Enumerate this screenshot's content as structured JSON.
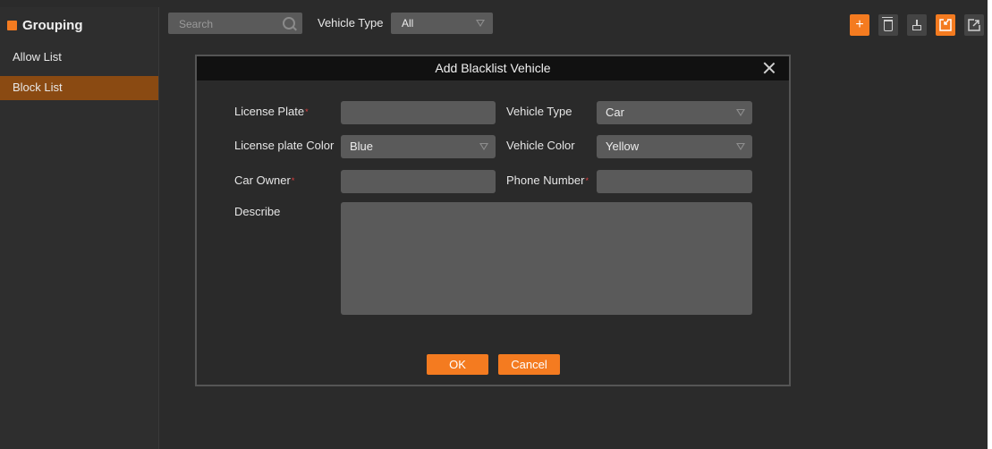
{
  "sidebar": {
    "title": "Grouping",
    "items": [
      {
        "label": "Allow List"
      },
      {
        "label": "Block List"
      }
    ]
  },
  "topbar": {
    "search_placeholder": "Search",
    "vehicle_type_label": "Vehicle Type",
    "vehicle_type_value": "All"
  },
  "toolbar": {
    "add_symbol": "+",
    "icons": [
      "add-icon",
      "trash-icon",
      "clean-icon",
      "import-icon",
      "export-icon"
    ]
  },
  "dialog": {
    "title": "Add Blacklist Vehicle",
    "fields": {
      "license_plate": {
        "label": "License Plate",
        "required": "*",
        "value": ""
      },
      "vehicle_type": {
        "label": "Vehicle Type",
        "value": "Car"
      },
      "plate_color": {
        "label": "License plate Color",
        "value": "Blue"
      },
      "vehicle_color": {
        "label": "Vehicle Color",
        "value": "Yellow"
      },
      "car_owner": {
        "label": "Car Owner",
        "required": "*",
        "value": ""
      },
      "phone_number": {
        "label": "Phone Number",
        "required": "*",
        "value": ""
      },
      "describe": {
        "label": "Describe",
        "value": ""
      }
    },
    "ok_label": "OK",
    "cancel_label": "Cancel"
  },
  "colors": {
    "accent": "#f47b20",
    "selected_item": "#8a4a12",
    "background": "#2b2b2b",
    "field": "#5a5a5a",
    "required": "#e04040"
  }
}
